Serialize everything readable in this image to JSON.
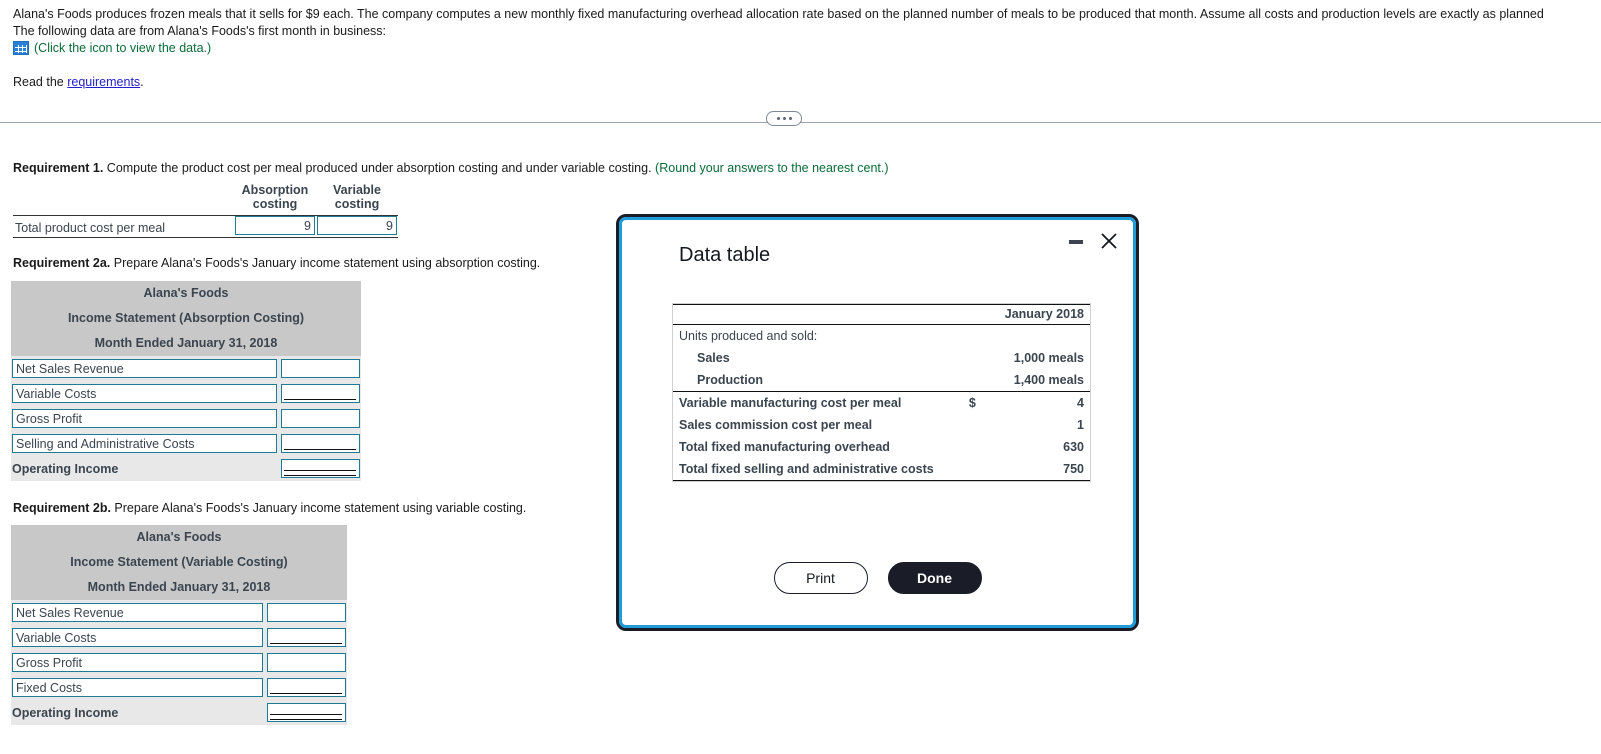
{
  "problem": {
    "paragraph_line1": "Alana's Foods produces frozen meals that it sells for $9 each. The company computes a new monthly fixed manufacturing overhead allocation rate based on the planned number of meals to be produced that month. Assume all costs and production levels are exactly as planned",
    "paragraph_line2": "The following data are from Alana's Foods's first month in business:",
    "data_icon_caption": "(Click the icon to view the data.)",
    "read_prefix": "Read the ",
    "read_link": "requirements",
    "read_suffix": "."
  },
  "requirement1": {
    "heading_bold": "Requirement 1.",
    "heading_text": " Compute the product cost per meal produced under absorption costing and under variable costing. ",
    "heading_note": "(Round your answers to the nearest cent.)",
    "col_headers": [
      {
        "line1": "Absorption",
        "line2": "costing"
      },
      {
        "line1": "Variable",
        "line2": "costing"
      }
    ],
    "row_label": "Total product cost per meal",
    "values": [
      "9",
      "9"
    ]
  },
  "requirement2a": {
    "heading_bold": "Requirement 2a.",
    "heading_text": " Prepare Alana's Foods's January income statement using absorption costing.",
    "title_line1": "Alana's Foods",
    "title_line2": "Income Statement (Absorption Costing)",
    "title_line3": "Month Ended January 31, 2018",
    "rows": [
      {
        "label": "Net Sales Revenue",
        "value": "",
        "underline": "none"
      },
      {
        "label": "Variable Costs",
        "value": "",
        "underline": "single"
      },
      {
        "label": "Gross Profit",
        "value": "",
        "underline": "none"
      },
      {
        "label": "Selling and Administrative Costs",
        "value": "",
        "underline": "single"
      }
    ],
    "total_label": "Operating Income",
    "total_value": ""
  },
  "requirement2b": {
    "heading_bold": "Requirement 2b.",
    "heading_text": " Prepare Alana's Foods's January income statement using variable costing.",
    "title_line1": "Alana's Foods",
    "title_line2": "Income Statement (Variable Costing)",
    "title_line3": "Month Ended January 31, 2018",
    "rows": [
      {
        "label": "Net Sales Revenue",
        "value": "",
        "underline": "none"
      },
      {
        "label": "Variable Costs",
        "value": "",
        "underline": "single"
      },
      {
        "label": "Gross Profit",
        "value": "",
        "underline": "none"
      },
      {
        "label": "Fixed Costs",
        "value": "",
        "underline": "single"
      }
    ],
    "total_label": "Operating Income",
    "total_value": ""
  },
  "dialog": {
    "title": "Data table",
    "column_header": "January 2018",
    "section_label": "Units produced and sold:",
    "rows": [
      {
        "name": "Sales",
        "currency": "",
        "amount": "1,000 meals"
      },
      {
        "name": "Production",
        "currency": "",
        "amount": "1,400 meals"
      },
      {
        "name": "Variable manufacturing cost per meal",
        "currency": "$",
        "amount": "4"
      },
      {
        "name": "Sales commission cost per meal",
        "currency": "",
        "amount": "1"
      },
      {
        "name": "Total fixed manufacturing overhead",
        "currency": "",
        "amount": "630"
      },
      {
        "name": "Total fixed selling and administrative costs",
        "currency": "",
        "amount": "750"
      }
    ],
    "print_label": "Print",
    "done_label": "Done"
  },
  "colors": {
    "link": "#2222CC",
    "green_note": "#0A6B37",
    "input_border": "#1F7A94",
    "table_header_bg": "#C8C8C8",
    "table_row_bg": "#E8E8E8",
    "dialog_accent": "#1F9BD8",
    "dialog_dark": "#1A1D28"
  }
}
